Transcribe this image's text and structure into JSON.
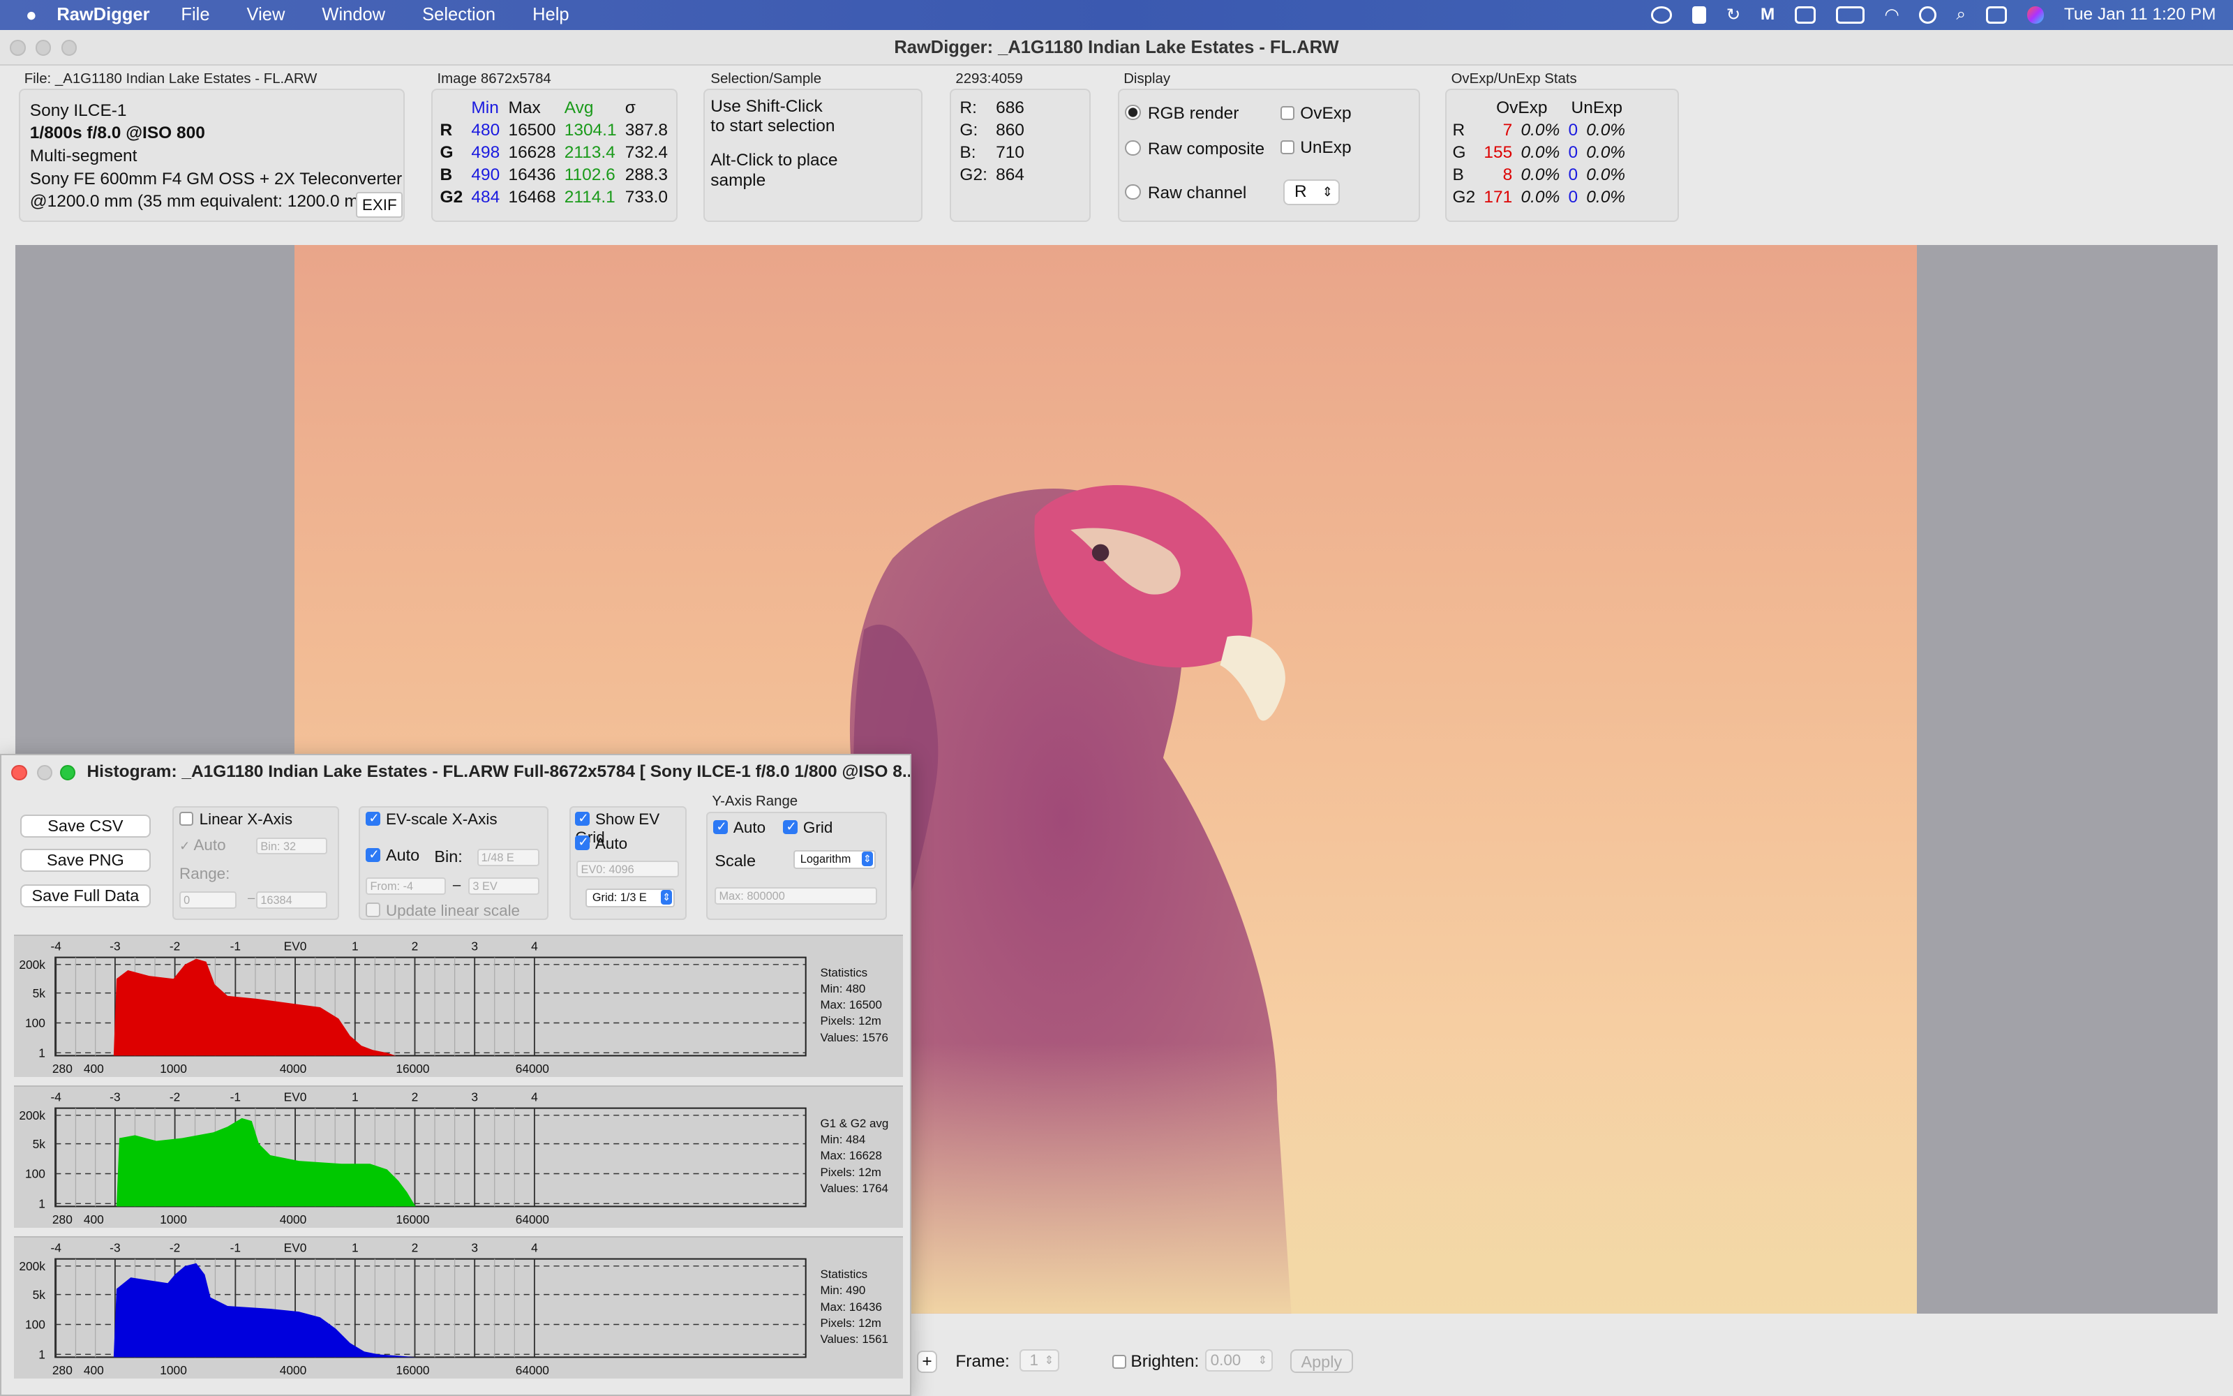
{
  "menubar": {
    "app": "RawDigger",
    "items": [
      "File",
      "View",
      "Window",
      "Selection",
      "Help"
    ],
    "datetime": "Tue Jan 11  1:20 PM"
  },
  "window": {
    "title": "RawDigger: _A1G1180 Indian Lake Estates - FL.ARW"
  },
  "file_panel": {
    "title": "File: _A1G1180 Indian Lake Estates - FL.ARW",
    "camera": "Sony ILCE-1",
    "exposure": "1/800s f/8.0 @ISO 800",
    "mode": "Multi-segment",
    "lens": "Sony FE 600mm F4 GM OSS + 2X Teleconverter",
    "focal": "@1200.0 mm (35 mm equivalent: 1200.0 mm)",
    "exif_button": "EXIF"
  },
  "image_panel": {
    "title": "Image 8672x5784",
    "headers": [
      "Min",
      "Max",
      "Avg",
      "σ"
    ],
    "rows": [
      {
        "ch": "R",
        "min": "480",
        "max": "16500",
        "avg": "1304.1",
        "sd": "387.8"
      },
      {
        "ch": "G",
        "min": "498",
        "max": "16628",
        "avg": "2113.4",
        "sd": "732.4"
      },
      {
        "ch": "B",
        "min": "490",
        "max": "16436",
        "avg": "1102.6",
        "sd": "288.3"
      },
      {
        "ch": "G2",
        "min": "484",
        "max": "16468",
        "avg": "2114.1",
        "sd": "733.0"
      }
    ]
  },
  "selection_panel": {
    "title": "Selection/Sample",
    "line1": "Use Shift-Click",
    "line2": "to start selection",
    "line3": "Alt-Click to place",
    "line4": "sample"
  },
  "pixel_panel": {
    "title": "2293:4059",
    "rows": [
      {
        "ch": "R:",
        "v": "686"
      },
      {
        "ch": "G:",
        "v": "860"
      },
      {
        "ch": "B:",
        "v": "710"
      },
      {
        "ch": "G2:",
        "v": "864"
      }
    ]
  },
  "display_panel": {
    "title": "Display",
    "rgb_render": "RGB render",
    "raw_composite": "Raw composite",
    "raw_channel": "Raw channel",
    "ovexp": "OvExp",
    "unexp": "UnExp",
    "channel_value": "R"
  },
  "ovexp_panel": {
    "title": "OvExp/UnExp Stats",
    "headers": [
      "OvExp",
      "UnExp"
    ],
    "rows": [
      {
        "ch": "R",
        "ov": "7",
        "ovp": "0.0%",
        "un": "0",
        "unp": "0.0%"
      },
      {
        "ch": "G",
        "ov": "155",
        "ovp": "0.0%",
        "un": "0",
        "unp": "0.0%"
      },
      {
        "ch": "B",
        "ov": "8",
        "ovp": "0.0%",
        "un": "0",
        "unp": "0.0%"
      },
      {
        "ch": "G2",
        "ov": "171",
        "ovp": "0.0%",
        "un": "0",
        "unp": "0.0%"
      }
    ]
  },
  "bottom_bar": {
    "plus": "+",
    "frame_label": "Frame:",
    "frame_value": "1",
    "brighten_label": "Brighten:",
    "brighten_value": "0.00",
    "apply": "Apply"
  },
  "histogram": {
    "title": "Histogram: _A1G1180 Indian Lake Estates - FL.ARW Full-8672x5784 [ Sony ILCE-1 f/8.0 1/800 @ISO 8...",
    "save_csv": "Save CSV",
    "save_png": "Save PNG",
    "save_full": "Save Full Data",
    "linear": {
      "label": "Linear X-Axis",
      "auto": "Auto",
      "bin": "Bin: 32",
      "range": "Range:",
      "from": "0",
      "to": "16384",
      "dash": "–"
    },
    "ev": {
      "label": "EV-scale X-Axis",
      "auto": "Auto",
      "bin_label": "Bin:",
      "bin": "1/48 E",
      "from": "From: -4",
      "to": "3 EV",
      "dash": "–",
      "update": "Update linear scale"
    },
    "grid": {
      "label": "Show EV Grid",
      "auto": "Auto",
      "ev0": "EV0: 4096",
      "grid": "Grid: 1/3 E"
    },
    "yaxis": {
      "label": "Y-Axis Range",
      "auto": "Auto",
      "grid": "Grid",
      "scale": "Scale",
      "scale_value": "Logarithm",
      "max": "Max: 800000"
    },
    "ev_ticks": [
      "-4",
      "-3",
      "-2",
      "-1",
      "EV0",
      "1",
      "2",
      "3",
      "4"
    ],
    "x_ticks": [
      "280",
      "400",
      "1000",
      "4000",
      "16000",
      "64000"
    ],
    "y_ticks": [
      "200k",
      "5k",
      "100",
      "1"
    ],
    "panels": [
      {
        "color": "#dd0000",
        "stats": [
          "Statistics",
          "Min: 480",
          "Max: 16500",
          "Pixels: 12m",
          "Values: 1576"
        ]
      },
      {
        "color": "#00c800",
        "stats": [
          "G1 & G2 avg",
          "Min: 484",
          "Max: 16628",
          "Pixels: 12m",
          "Values: 1764"
        ]
      },
      {
        "color": "#0000dd",
        "stats": [
          "Statistics",
          "Min: 490",
          "Max: 16436",
          "Pixels: 12m",
          "Values: 1561"
        ]
      }
    ]
  }
}
